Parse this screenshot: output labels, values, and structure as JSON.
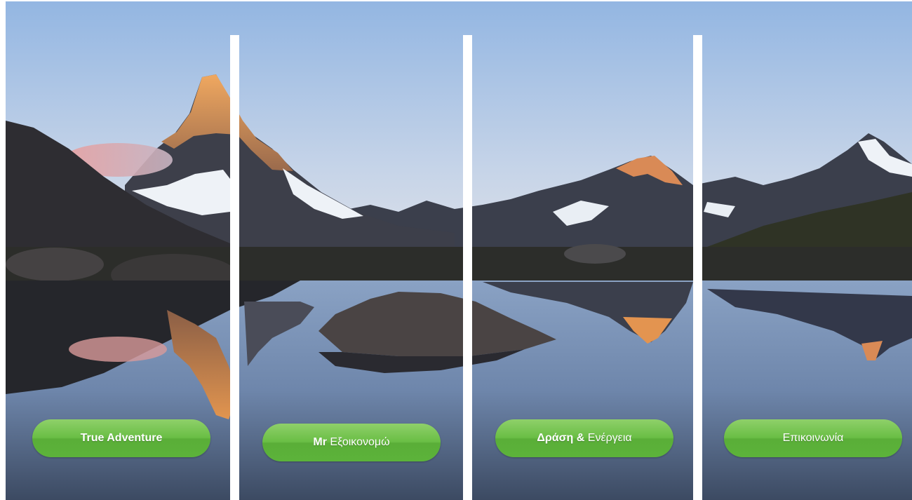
{
  "scene": {
    "colors": {
      "sky_top": "#9bbde6",
      "sky_horizon": "#d9e2ee",
      "peak_glow": "#e49a5a",
      "snow": "#f1f4f8",
      "rock_dark": "#3a3c45",
      "water_top": "#6c86ad",
      "water_bottom": "#3f4e66",
      "divider": "#ffffff"
    }
  },
  "nav": {
    "button_color": "#6abe45",
    "items": [
      {
        "label": "True Adventure"
      },
      {
        "label_bold": "Mr",
        "label_rest": " Εξοικονομώ"
      },
      {
        "label_bold": "Δράση &",
        "label_rest": " Ενέργεια"
      },
      {
        "label_rest": "Επικοινωνία"
      }
    ]
  }
}
